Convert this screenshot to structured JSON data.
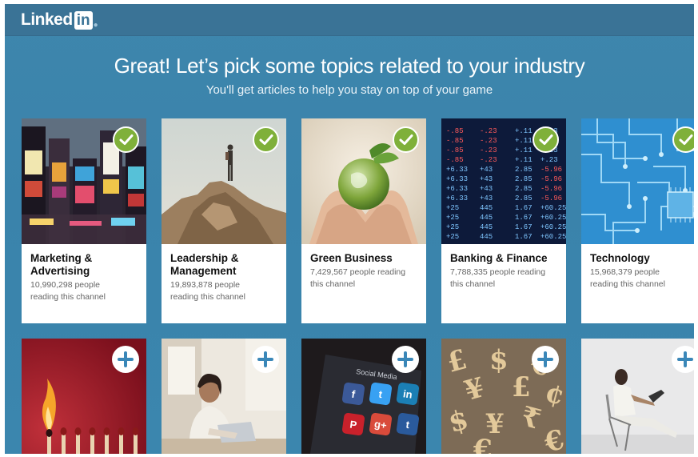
{
  "header": {
    "logo_text": "Linked",
    "logo_in": "in"
  },
  "main": {
    "headline": "Great! Let’s pick some topics related to your industry",
    "subline": "You'll get articles to help you stay on top of your game"
  },
  "topics": [
    {
      "title_line1": "Marketing &",
      "title_line2": "Advertising",
      "count": "10,990,298 people",
      "reading": "reading this channel",
      "selected": true
    },
    {
      "title_line1": "Leadership &",
      "title_line2": "Management",
      "count": "19,893,878 people",
      "reading": "reading this channel",
      "selected": true
    },
    {
      "title_line1": "Green Business",
      "title_line2": "",
      "count": "7,429,567 people reading",
      "reading": "this channel",
      "selected": true
    },
    {
      "title_line1": "Banking & Finance",
      "title_line2": "",
      "count": "7,788,335 people reading",
      "reading": "this channel",
      "selected": true
    },
    {
      "title_line1": "Technology",
      "title_line2": "",
      "count": "15,968,379 people",
      "reading": "reading this channel",
      "selected": true
    }
  ],
  "stock_tickers": [
    "-.85",
    "-.23",
    "+.11",
    "+.23",
    "+6.33",
    "+43",
    "2.85",
    "-5.96",
    "+25",
    "445",
    "1.67",
    "+60.25"
  ],
  "social_tiles": [
    "f",
    "t",
    "in",
    "P",
    "g+",
    "t"
  ],
  "currency_symbols": [
    "£",
    "$",
    "€",
    "¥",
    "£",
    "¢",
    "$",
    "¥",
    "₹",
    "€",
    "€"
  ],
  "social_label": "Social Media",
  "colors": {
    "brand": "#3a7396",
    "check": "#7fb03a",
    "plus": "#3a87b8"
  }
}
